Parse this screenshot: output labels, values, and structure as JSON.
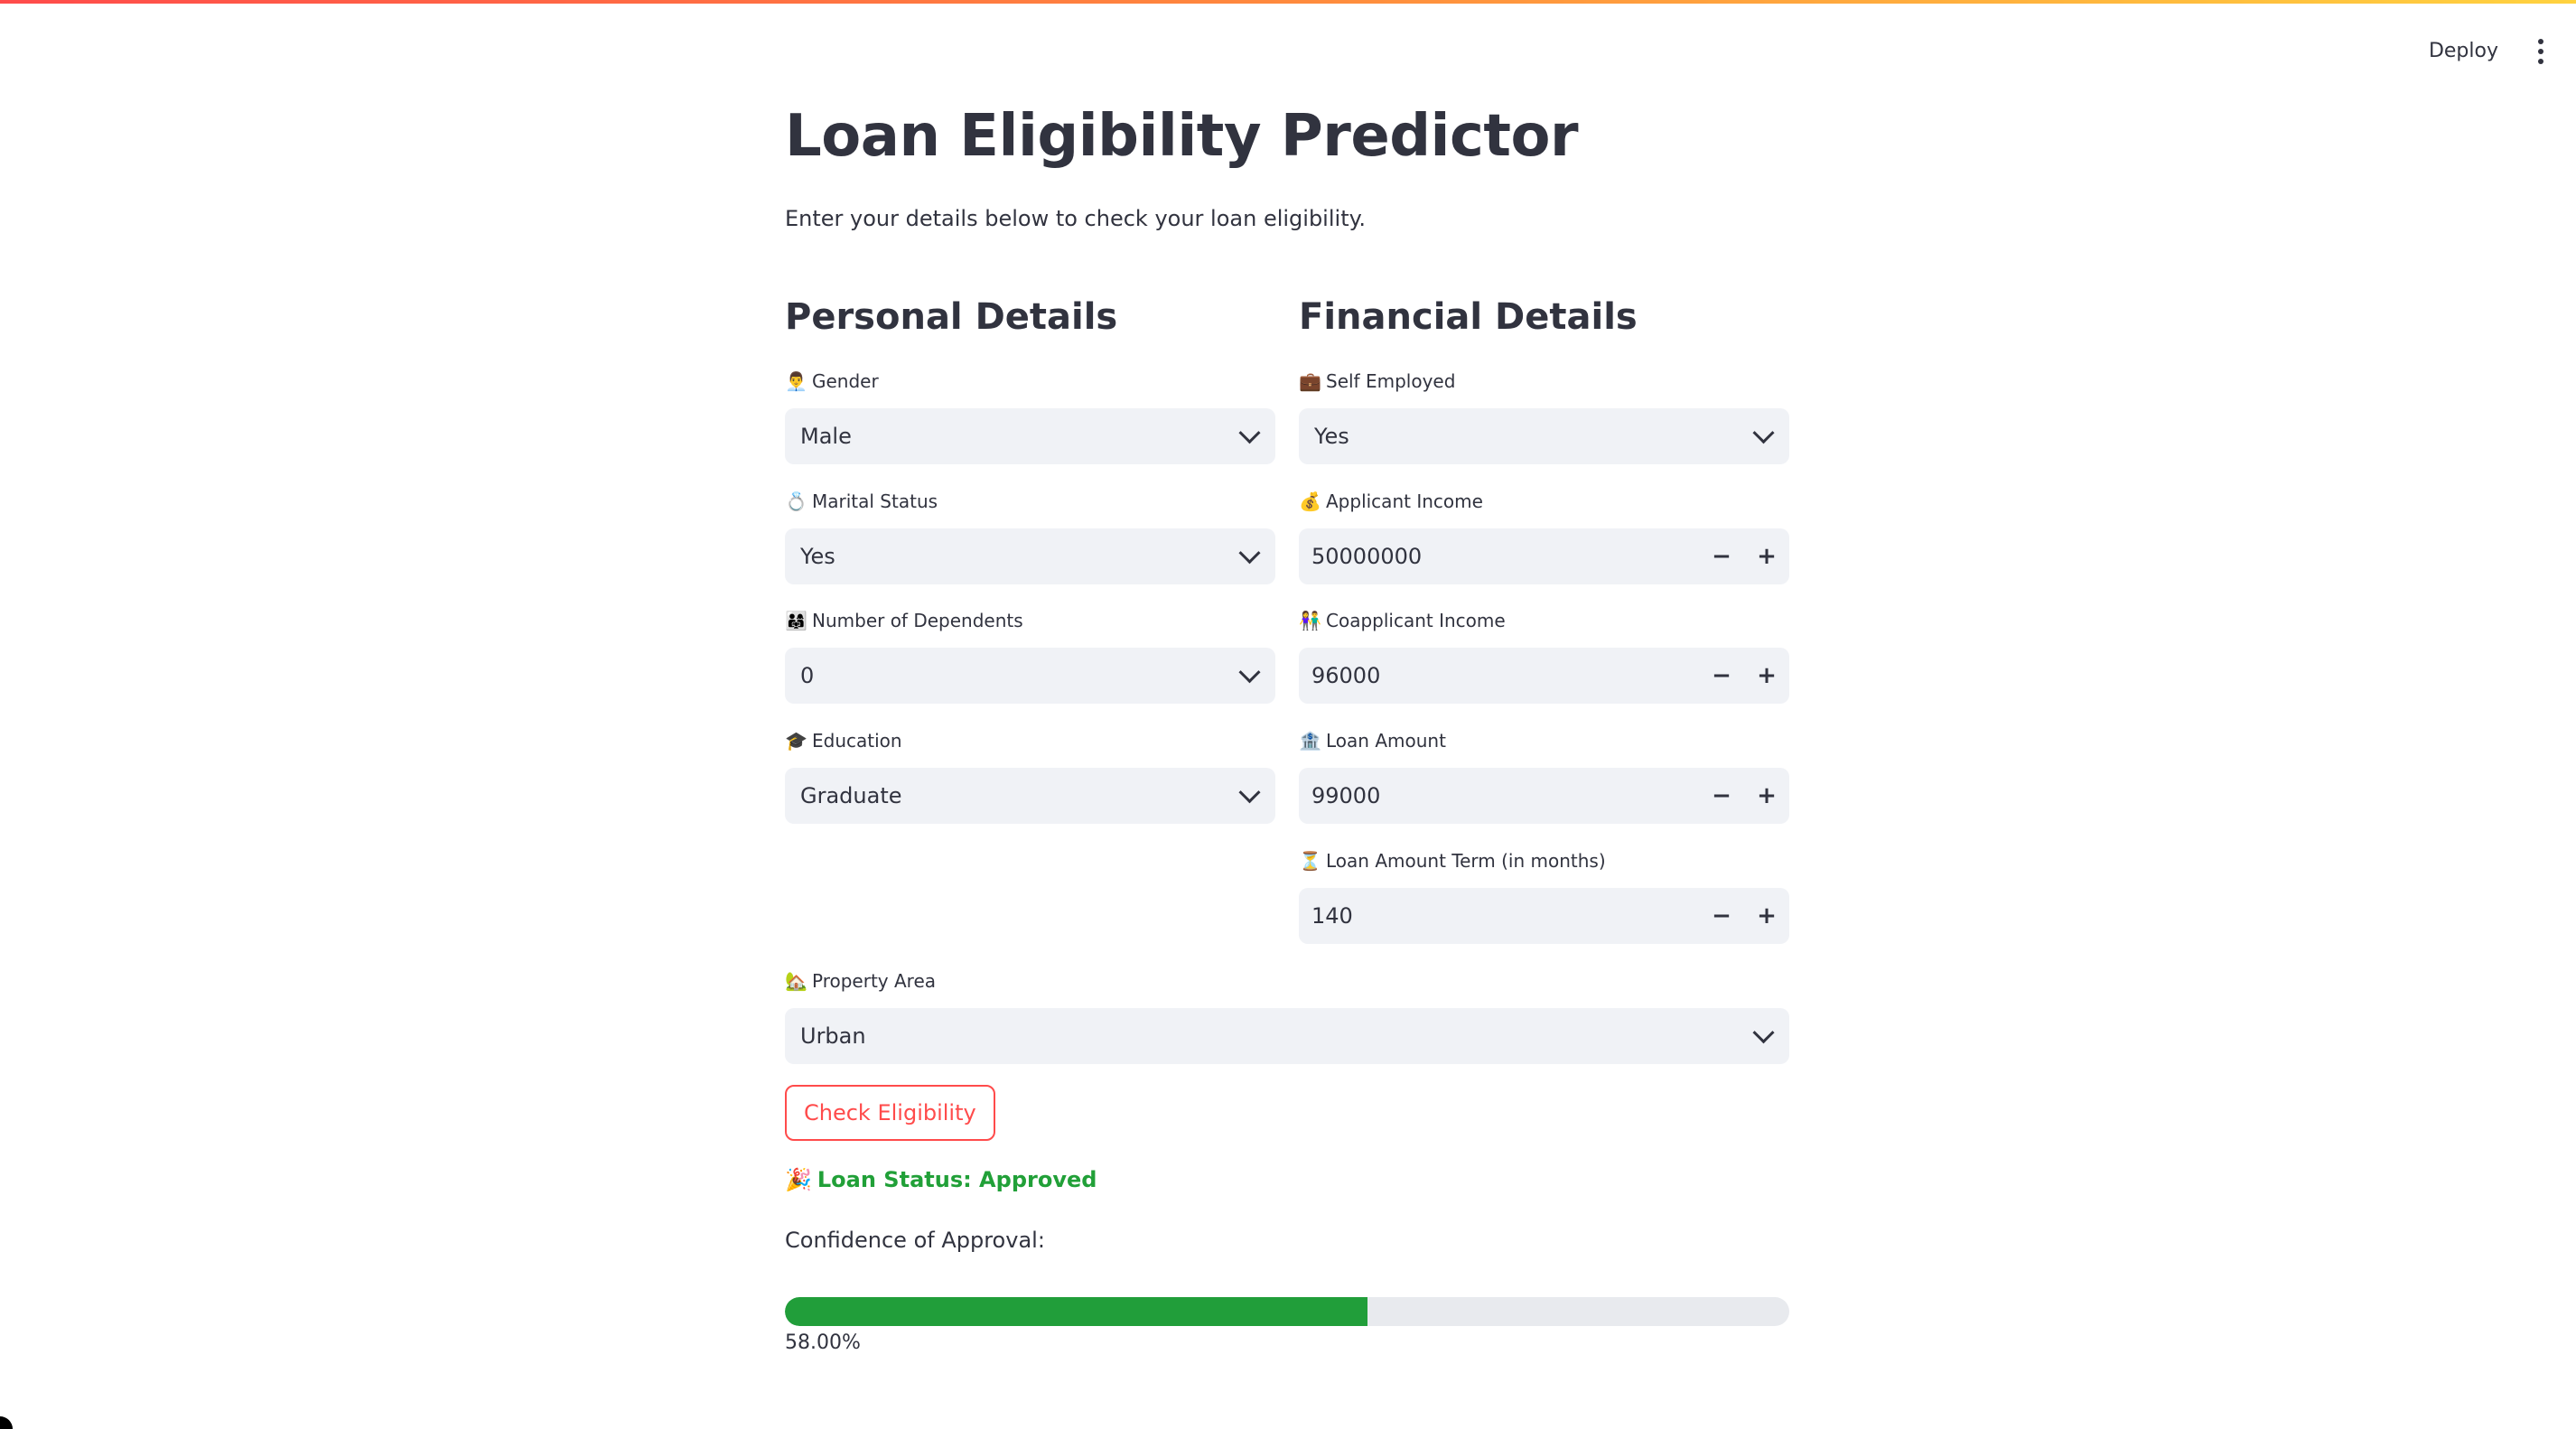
{
  "header": {
    "deploy_label": "Deploy"
  },
  "page": {
    "title": "Loan Eligibility Predictor",
    "subtitle": "Enter your details below to check your loan eligibility."
  },
  "personal": {
    "title": "Personal Details",
    "fields": [
      {
        "emoji": "👨‍💼",
        "label": "Gender",
        "value": "Male"
      },
      {
        "emoji": "💍",
        "label": "Marital Status",
        "value": "Yes"
      },
      {
        "emoji": "👨‍👩‍👧",
        "label": "Number of Dependents",
        "value": "0"
      },
      {
        "emoji": "🎓",
        "label": "Education",
        "value": "Graduate"
      }
    ]
  },
  "financial": {
    "title": "Financial Details",
    "self_employed": {
      "emoji": "💼",
      "label": "Self Employed",
      "value": "Yes"
    },
    "fields": [
      {
        "emoji": "💰",
        "label": "Applicant Income",
        "value": "50000000"
      },
      {
        "emoji": "👫",
        "label": "Coapplicant Income",
        "value": "96000"
      },
      {
        "emoji": "🏦",
        "label": "Loan Amount",
        "value": "99000"
      },
      {
        "emoji": "⏳",
        "label": "Loan Amount Term (in months)",
        "value": "140"
      }
    ],
    "minus_symbol": "−",
    "plus_symbol": "+"
  },
  "property": {
    "emoji": "🏡",
    "label": "Property Area",
    "value": "Urban"
  },
  "actions": {
    "check_label": "Check Eligibility"
  },
  "result": {
    "emoji": "🎉",
    "status_text": "Loan Status: Approved",
    "confidence_label": "Confidence of Approval:",
    "confidence_fraction": 0.58,
    "confidence_text": "58.00%"
  },
  "colors": {
    "accent": "#ff4b4b",
    "success": "#21a038",
    "input_bg": "#f0f2f6"
  },
  "icons": {
    "menu": "kebab-menu-icon",
    "dropdown": "chevron-down-icon"
  }
}
